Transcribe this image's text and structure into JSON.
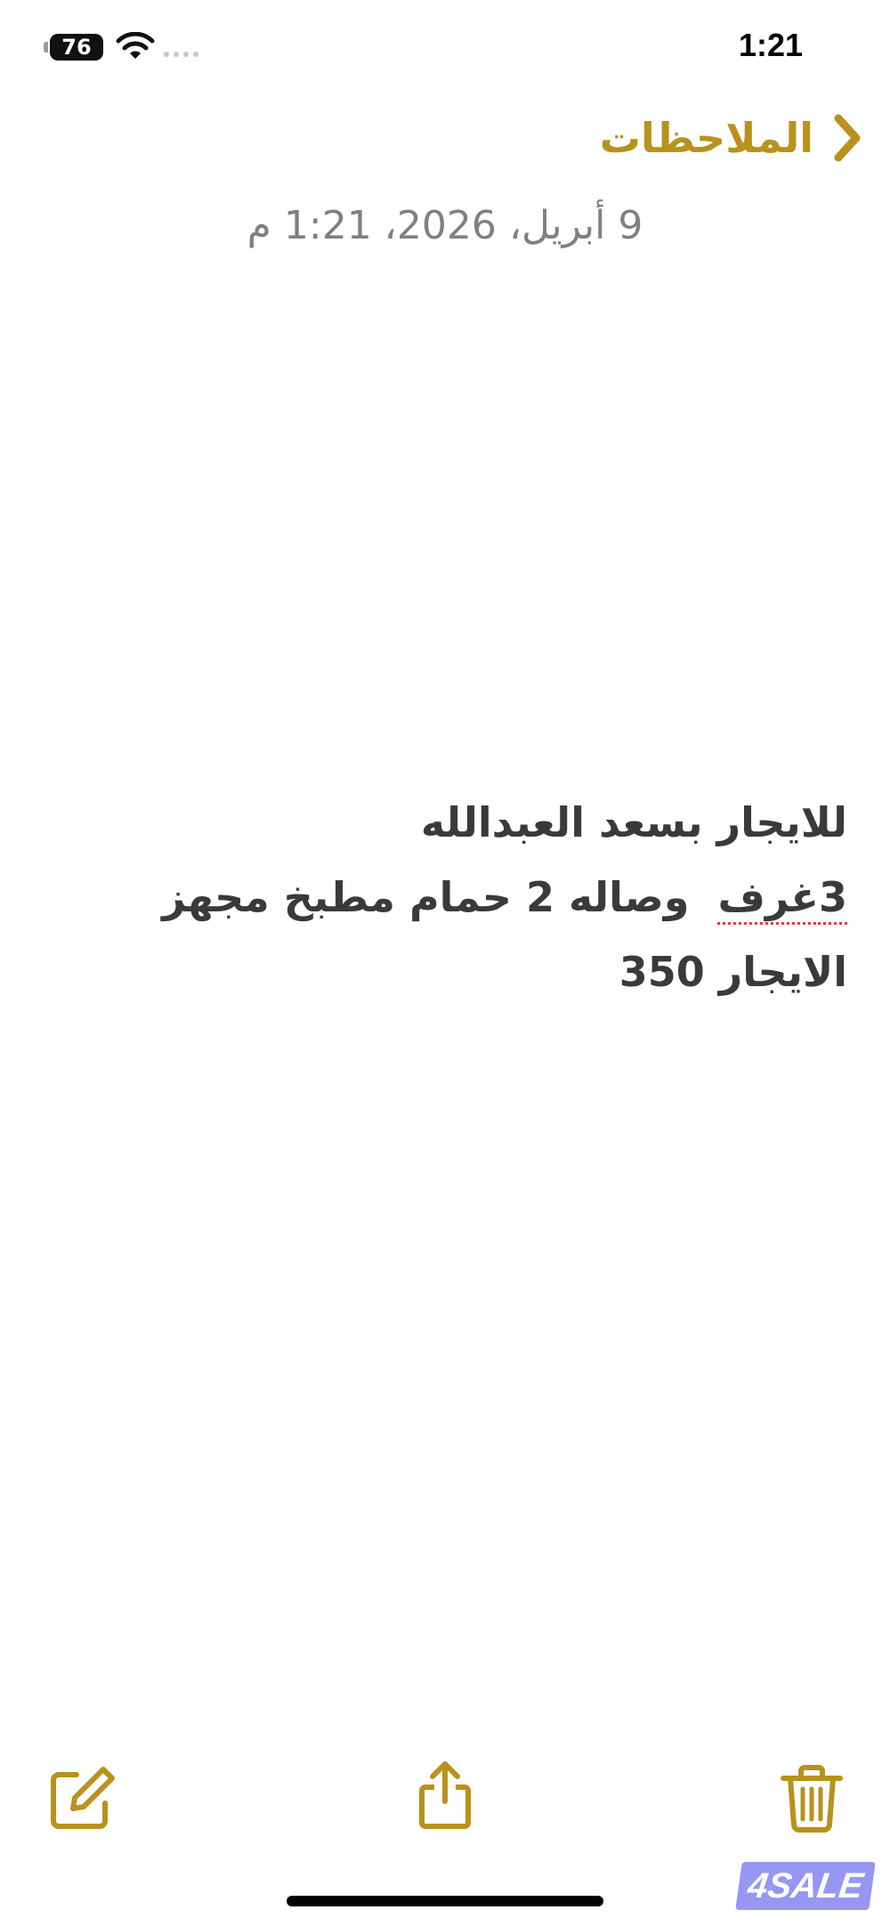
{
  "status_bar": {
    "battery_level": "76",
    "time": "1:21",
    "icons": [
      "battery-icon",
      "wifi-icon",
      "cellular-dots-icon"
    ]
  },
  "nav": {
    "back_label": "الملاحظات",
    "back_icon": "chevron-back-icon",
    "accent_color": "#b8921b"
  },
  "note": {
    "date": "9 أبريل، 2026، 1:21 م",
    "lines": [
      {
        "text": "للايجار بسعد العبدالله"
      },
      {
        "misspelled_word": "3غرف",
        "rest": "  وصاله 2 حمام مطبخ مجهز"
      },
      {
        "text": "الايجار 350"
      }
    ]
  },
  "toolbar": {
    "compose_icon": "compose-icon",
    "share_icon": "share-icon",
    "trash_icon": "trash-icon"
  },
  "watermark": {
    "text": "4SALE"
  }
}
